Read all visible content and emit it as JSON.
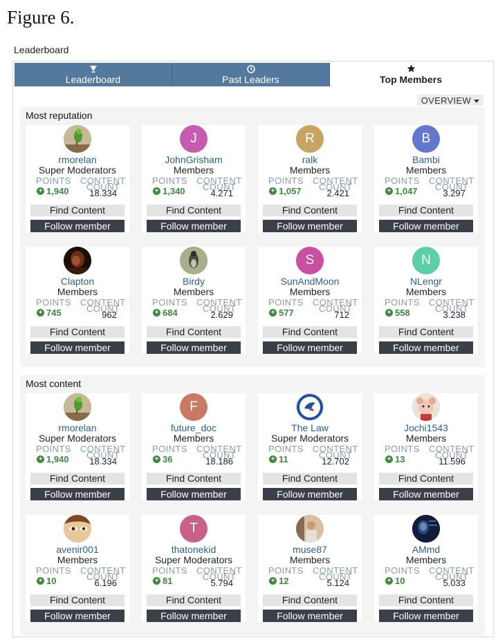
{
  "figure_caption": "Figure 6.",
  "page_heading": "Leaderboard",
  "tabs": [
    {
      "label": "Leaderboard",
      "icon": "trophy-icon"
    },
    {
      "label": "Past Leaders",
      "icon": "clock-icon"
    },
    {
      "label": "Top Members",
      "icon": "star-icon"
    }
  ],
  "active_tab": 2,
  "overview_label": "OVERVIEW",
  "stat_labels": {
    "points": "POINTS",
    "content": "CONTENT",
    "count": "COUNT"
  },
  "buttons": {
    "find": "Find Content",
    "follow": "Follow member"
  },
  "colors": {
    "tab_bg": "#53799e",
    "points_green": "#3c8a3c",
    "follow_btn": "#3b3f48",
    "username_link": "#2c5d8c"
  },
  "sections": [
    {
      "title": "Most reputation",
      "members": [
        {
          "name": "rmorelan",
          "role": "Super Moderators",
          "points": "1,940",
          "content": "18.334",
          "avatar": {
            "type": "photo",
            "icon": "parrot-photo-icon",
            "color": "#6a8a4a"
          }
        },
        {
          "name": "JohnGrisham",
          "role": "Members",
          "points": "1,340",
          "content": "4.271",
          "avatar": {
            "type": "letter",
            "letter": "J",
            "color": "#c75bb0"
          }
        },
        {
          "name": "ralk",
          "role": "Members",
          "points": "1,057",
          "content": "2.421",
          "avatar": {
            "type": "letter",
            "letter": "R",
            "color": "#c8a462"
          }
        },
        {
          "name": "Bambi",
          "role": "Members",
          "points": "1,047",
          "content": "3.297",
          "avatar": {
            "type": "letter",
            "letter": "B",
            "color": "#6178cc"
          }
        },
        {
          "name": "Clapton",
          "role": "Members",
          "points": "745",
          "content": "962",
          "avatar": {
            "type": "photo",
            "icon": "dark-portrait-photo-icon",
            "color": "#5a2a18"
          }
        },
        {
          "name": "Birdy",
          "role": "Members",
          "points": "684",
          "content": "2.629",
          "avatar": {
            "type": "photo",
            "icon": "bird-photo-icon",
            "color": "#7c8a5a"
          }
        },
        {
          "name": "SunAndMoon",
          "role": "Members",
          "points": "577",
          "content": "712",
          "avatar": {
            "type": "letter",
            "letter": "S",
            "color": "#c84fa2"
          }
        },
        {
          "name": "NLengr",
          "role": "Members",
          "points": "558",
          "content": "3.238",
          "avatar": {
            "type": "letter",
            "letter": "N",
            "color": "#5ccfa8"
          }
        }
      ]
    },
    {
      "title": "Most content",
      "members": [
        {
          "name": "rmorelan",
          "role": "Super Moderators",
          "points": "1,940",
          "content": "18.334",
          "avatar": {
            "type": "photo",
            "icon": "parrot-photo-icon",
            "color": "#6a8a4a"
          }
        },
        {
          "name": "future_doc",
          "role": "Members",
          "points": "36",
          "content": "18.186",
          "avatar": {
            "type": "letter",
            "letter": "F",
            "color": "#c87a62"
          }
        },
        {
          "name": "The Law",
          "role": "Super Moderators",
          "points": "11",
          "content": "12.702",
          "avatar": {
            "type": "photo",
            "icon": "blue-jays-logo-icon",
            "color": "#1d4fa0"
          }
        },
        {
          "name": "Jochi1543",
          "role": "Members",
          "points": "13",
          "content": "11.596",
          "avatar": {
            "type": "photo",
            "icon": "plush-toy-photo-icon",
            "color": "#e3c8b8"
          }
        },
        {
          "name": "avenir001",
          "role": "Members",
          "points": "10",
          "content": "6.196",
          "avatar": {
            "type": "photo",
            "icon": "eye-photo-icon",
            "color": "#c8a068"
          }
        },
        {
          "name": "thatonekid",
          "role": "Super Moderators",
          "points": "81",
          "content": "5.794",
          "avatar": {
            "type": "letter",
            "letter": "T",
            "color": "#c8608a"
          }
        },
        {
          "name": "muse87",
          "role": "Members",
          "points": "12",
          "content": "5.124",
          "avatar": {
            "type": "photo",
            "icon": "person-photo-icon",
            "color": "#b88a6a"
          }
        },
        {
          "name": "AMmd",
          "role": "Members",
          "points": "10",
          "content": "5.033",
          "avatar": {
            "type": "photo",
            "icon": "dark-blue-photo-icon",
            "color": "#1a2e52"
          }
        }
      ]
    }
  ]
}
